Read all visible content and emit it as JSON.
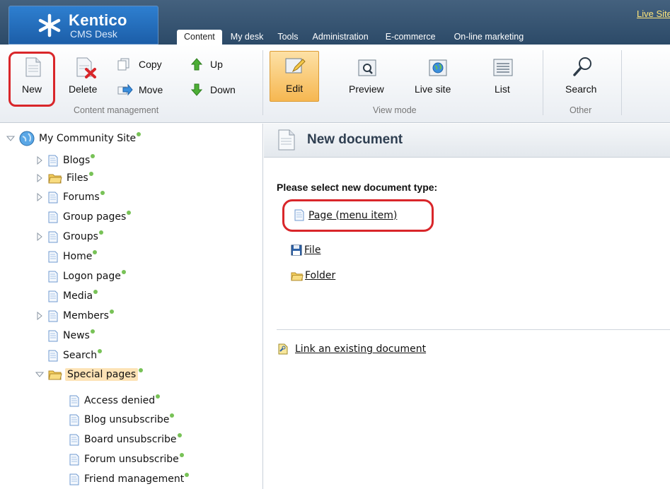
{
  "app": {
    "logo_name": "Kentico",
    "logo_sub": "CMS Desk",
    "live_site_link": "Live Site"
  },
  "tabs": [
    {
      "label": "Content",
      "active": true
    },
    {
      "label": "My desk"
    },
    {
      "label": "Tools"
    },
    {
      "label": "Administration"
    },
    {
      "label": "E-commerce"
    },
    {
      "label": "On-line marketing"
    }
  ],
  "toolbar": {
    "content_management": {
      "group_label": "Content management",
      "new": "New",
      "delete": "Delete",
      "copy": "Copy",
      "move": "Move",
      "up": "Up",
      "down": "Down"
    },
    "view_mode": {
      "group_label": "View mode",
      "edit": "Edit",
      "preview": "Preview",
      "live_site": "Live site",
      "list": "List"
    },
    "other": {
      "group_label": "Other",
      "search": "Search"
    }
  },
  "tree": {
    "root": "My Community Site",
    "items": [
      {
        "label": "Blogs",
        "expandable": true,
        "icon": "document-icon"
      },
      {
        "label": "Files",
        "expandable": true,
        "icon": "folder-icon"
      },
      {
        "label": "Forums",
        "expandable": true,
        "icon": "document-icon"
      },
      {
        "label": "Group pages",
        "expandable": false,
        "icon": "document-icon"
      },
      {
        "label": "Groups",
        "expandable": true,
        "icon": "document-icon"
      },
      {
        "label": "Home",
        "expandable": false,
        "icon": "document-icon"
      },
      {
        "label": "Logon page",
        "expandable": false,
        "icon": "document-icon"
      },
      {
        "label": "Media",
        "expandable": false,
        "icon": "document-icon"
      },
      {
        "label": "Members",
        "expandable": true,
        "icon": "document-icon"
      },
      {
        "label": "News",
        "expandable": false,
        "icon": "document-icon"
      },
      {
        "label": "Search",
        "expandable": false,
        "icon": "document-icon"
      },
      {
        "label": "Special pages",
        "expandable": true,
        "expanded": true,
        "selected": true,
        "icon": "folder-icon"
      }
    ],
    "special_children": [
      {
        "label": "Access denied"
      },
      {
        "label": "Blog unsubscribe"
      },
      {
        "label": "Board unsubscribe"
      },
      {
        "label": "Forum unsubscribe"
      },
      {
        "label": "Friend management"
      }
    ]
  },
  "panel": {
    "title": "New document",
    "prompt": "Please select new document type:",
    "options": [
      {
        "label": "Page (menu item)",
        "icon": "page-icon"
      },
      {
        "label": "File",
        "icon": "floppy-disk-icon"
      },
      {
        "label": "Folder",
        "icon": "folder-icon"
      }
    ],
    "link_existing": "Link an existing document"
  },
  "colors": {
    "header": "#3a5877",
    "accent_orange": "#f7b54a",
    "highlight_red": "#d9262a",
    "status_green": "#78c257"
  }
}
